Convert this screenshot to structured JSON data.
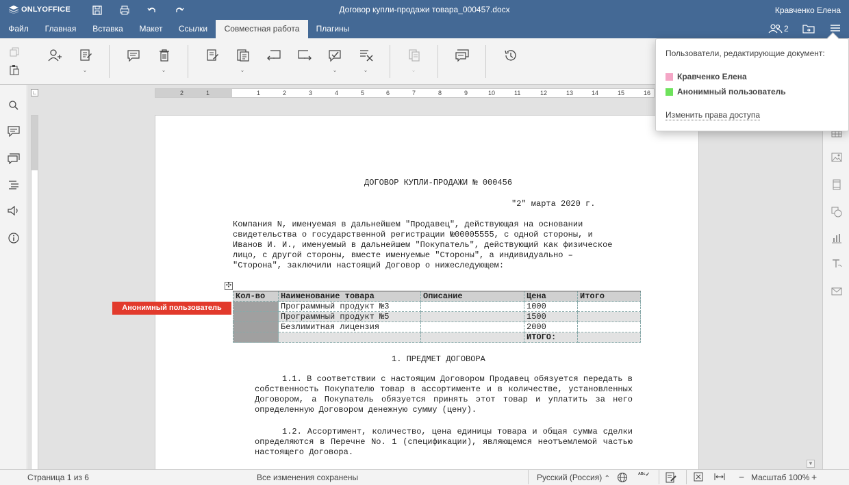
{
  "app": {
    "logo": "ONLYOFFICE",
    "title": "Договор купли-продажи товара_000457.docx",
    "user": "Кравченко Елена"
  },
  "menu": {
    "tabs": [
      "Файл",
      "Главная",
      "Вставка",
      "Макет",
      "Ссылки",
      "Совместная работа",
      "Плагины"
    ],
    "active_tab": "Совместная работа",
    "users_count": "2"
  },
  "ruler": {
    "h_numbers": [
      "2",
      "1",
      "1",
      "2",
      "3",
      "4",
      "5",
      "6",
      "7",
      "8",
      "9",
      "10",
      "11",
      "12",
      "13",
      "14",
      "15",
      "16"
    ]
  },
  "document": {
    "heading": "ДОГОВОР КУПЛИ-ПРОДАЖИ № 000456",
    "date": "\"2\" марта 2020 г.",
    "intro": [
      "Компания N, именуемая в дальнейшем \"Продавец\", действующая на основании",
      "свидетельства о государственной регистрации №00005555, с одной стороны, и",
      "Иванов И. И., именуемый в дальнейшем \"Покупатель\", действующий как физическое",
      "лицо, с другой стороны, вместе именуемые \"Стороны\", а индивидуально –",
      "\"Сторона\", заключили настоящий Договор о нижеследующем:"
    ],
    "table": {
      "headers": [
        "Кол-во",
        "Наименование товара",
        "Описание",
        "Цена",
        "Итого"
      ],
      "rows": [
        [
          "",
          "Программный продукт №3",
          "",
          "1000",
          ""
        ],
        [
          "",
          "Программный продукт №5",
          "",
          "1500",
          ""
        ],
        [
          "",
          "Безлимитная лицензия",
          "",
          "2000",
          ""
        ],
        [
          "",
          "",
          "",
          "ИТОГО:",
          ""
        ]
      ]
    },
    "section1": "1. ПРЕДМЕТ ДОГОВОРА",
    "p11": "1.1. В соответствии с настоящим Договором Продавец обязуется передать в собственность Покупателю товар в ассортименте и в количестве, установленных Договором, а Покупатель обязуется принять этот товар и уплатить за него определенную Договором денежную сумму (цену).",
    "p12": "1.2. Ассортимент, количество, цена единицы товара и общая сумма сделки определяются в Перечне No. 1 (спецификации), являющемся неотъемлемой частью настоящего Договора."
  },
  "collab_label": "Анонимный пользователь",
  "popup": {
    "title": "Пользователи, редактирующие документ:",
    "users": [
      {
        "name": "Кравченко Елена",
        "color": "#f4a6c6"
      },
      {
        "name": "Анонимный пользователь",
        "color": "#6ee25c"
      }
    ],
    "link": "Изменить права доступа"
  },
  "status": {
    "page": "Страница 1 из 6",
    "saved": "Все изменения сохранены",
    "language": "Русский (Россия)",
    "zoom": "Масштаб 100%"
  },
  "colors": {
    "header": "#446995",
    "anon_label": "#e23a2c"
  }
}
